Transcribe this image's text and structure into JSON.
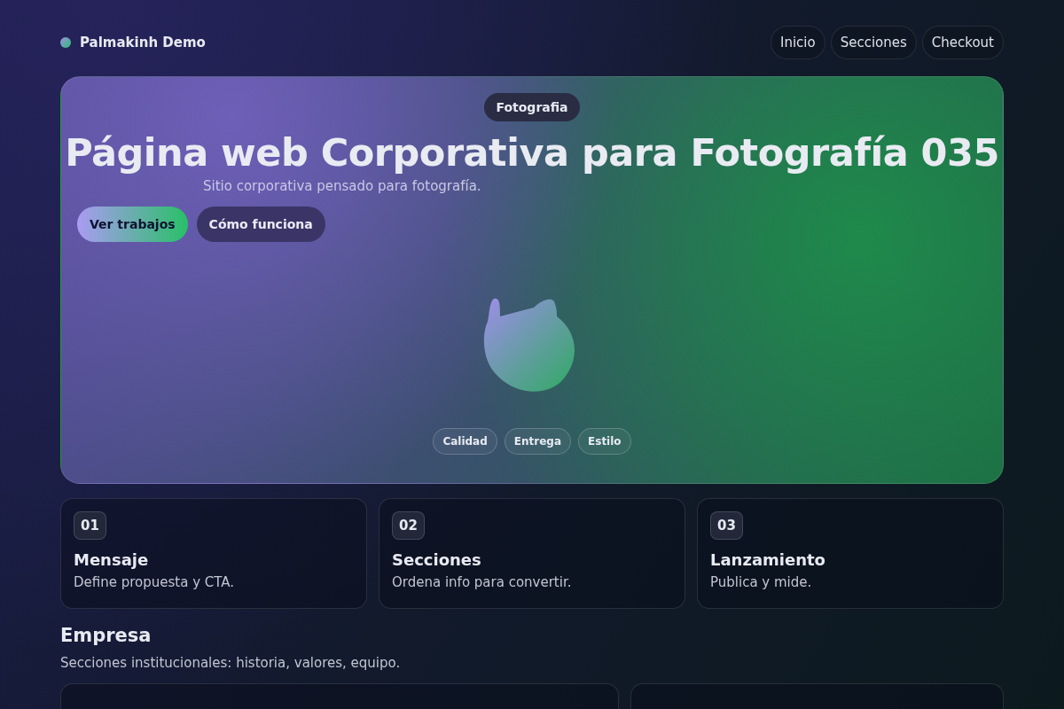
{
  "brand": {
    "name": "Palmakinh Demo"
  },
  "nav": [
    {
      "label": "Inicio"
    },
    {
      "label": "Secciones"
    },
    {
      "label": "Checkout"
    }
  ],
  "hero": {
    "badge": "Fotografia",
    "title": "Página web Corporativa para Fotografía 035",
    "subtitle": "Sitio corporativa pensado para fotografía.",
    "buttons": [
      {
        "label": "Ver trabajos",
        "kind": "primary"
      },
      {
        "label": "Cómo funciona",
        "kind": "secondary"
      }
    ],
    "tags": [
      "Calidad",
      "Entrega",
      "Estilo"
    ]
  },
  "steps": [
    {
      "number": "01",
      "title": "Mensaje",
      "text": "Define propuesta y CTA."
    },
    {
      "number": "02",
      "title": "Secciones",
      "text": "Ordena info para convertir."
    },
    {
      "number": "03",
      "title": "Lanzamiento",
      "text": "Publica y mide."
    }
  ],
  "section": {
    "title": "Empresa",
    "text": "Secciones institucionales: historia, valores, equipo."
  }
}
